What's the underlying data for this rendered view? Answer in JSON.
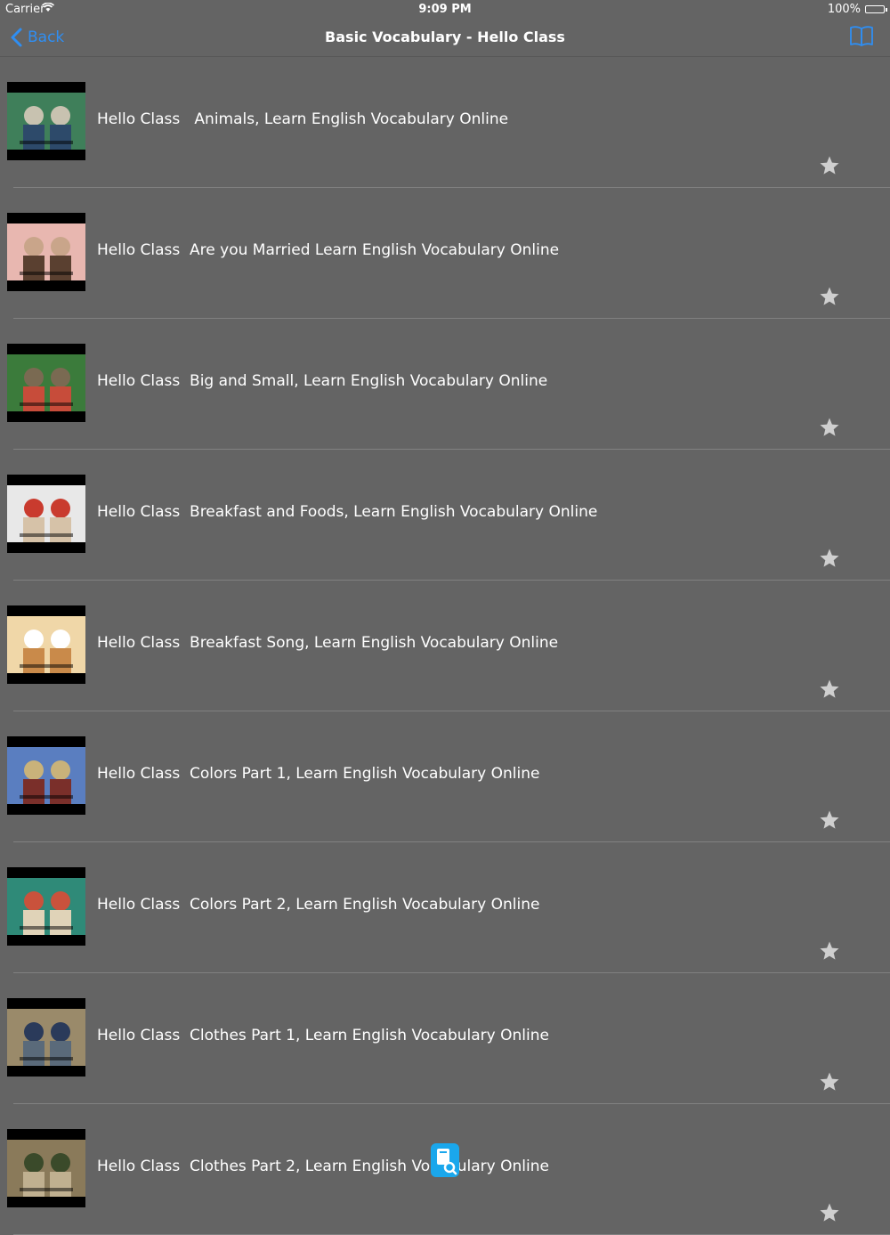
{
  "status": {
    "carrier": "Carrier",
    "time": "9:09 PM",
    "battery": "100%"
  },
  "nav": {
    "back_label": "Back",
    "title": "Basic Vocabulary - Hello Class",
    "accent_color": "#2f8ef2"
  },
  "videos": [
    {
      "title": "Hello Class   Animals, Learn English Vocabulary Online",
      "thumb_icon": "video-thumbnail"
    },
    {
      "title": "Hello Class  Are you Married Learn English Vocabulary Online",
      "thumb_icon": "video-thumbnail"
    },
    {
      "title": "Hello Class  Big and Small, Learn English Vocabulary Online",
      "thumb_icon": "video-thumbnail"
    },
    {
      "title": "Hello Class  Breakfast and Foods, Learn English Vocabulary Online",
      "thumb_icon": "video-thumbnail"
    },
    {
      "title": "Hello Class  Breakfast Song, Learn English Vocabulary Online",
      "thumb_icon": "video-thumbnail"
    },
    {
      "title": "Hello Class  Colors Part 1, Learn English Vocabulary Online",
      "thumb_icon": "video-thumbnail"
    },
    {
      "title": "Hello Class  Colors Part 2, Learn English Vocabulary Online",
      "thumb_icon": "video-thumbnail"
    },
    {
      "title": "Hello Class  Clothes Part 1, Learn English Vocabulary Online",
      "thumb_icon": "video-thumbnail"
    },
    {
      "title": "Hello Class  Clothes Part 2, Learn English Vocabulary Online",
      "thumb_icon": "video-thumbnail"
    }
  ],
  "colors": {
    "background": "#646464",
    "star": "#cfcfcf",
    "divider": "#818181"
  }
}
